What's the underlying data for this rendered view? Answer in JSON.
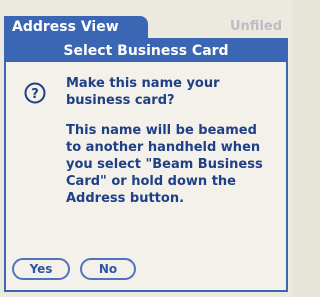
{
  "app": {
    "title": "Address View",
    "header_right": "Unfiled"
  },
  "dialog": {
    "title": "Select Business Card",
    "question": "Make this name your business card?",
    "detail": "This name will be beamed to another handheld when you select \"Beam Business Card\" or hold down the Address button.",
    "icon": "question-icon"
  },
  "buttons": {
    "yes": "Yes",
    "no": "No"
  },
  "colors": {
    "title_bar": "#3a66b3",
    "text": "#1f3f86",
    "background": "#f3f1e9"
  }
}
